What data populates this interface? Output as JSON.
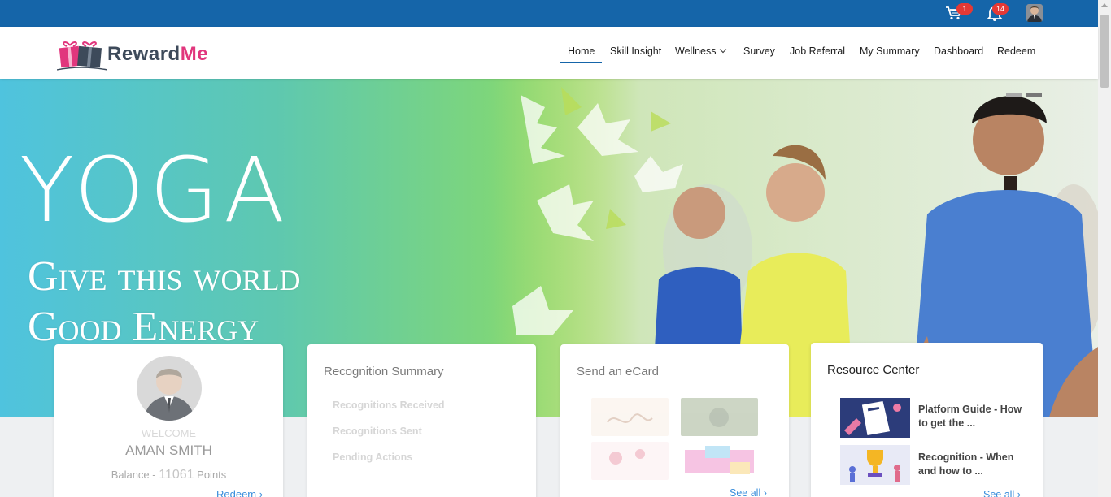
{
  "topbar": {
    "cart_count": "1",
    "notification_count": "14"
  },
  "brand": {
    "name_part1": "Reward",
    "name_part2": "Me"
  },
  "nav": {
    "items": [
      {
        "label": "Home"
      },
      {
        "label": "Skill Insight"
      },
      {
        "label": "Wellness"
      },
      {
        "label": "Survey"
      },
      {
        "label": "Job Referral"
      },
      {
        "label": "My Summary"
      },
      {
        "label": "Dashboard"
      },
      {
        "label": "Redeem"
      }
    ],
    "active": "Home"
  },
  "hero": {
    "title": "YOGA",
    "subtitle_line1": "Give this world",
    "subtitle_line2": "Good Energy"
  },
  "welcome_card": {
    "label": "WELCOME",
    "name": "AMAN SMITH",
    "balance_prefix": "Balance - ",
    "balance_points": "11061",
    "balance_suffix": " Points",
    "redeem_link": "Redeem ›"
  },
  "recognition_card": {
    "title": "Recognition Summary",
    "items": [
      {
        "label": "Recognitions Received"
      },
      {
        "label": "Recognitions Sent"
      },
      {
        "label": "Pending Actions"
      }
    ]
  },
  "ecard_card": {
    "title": "Send an eCard",
    "see_all": "See all ›"
  },
  "resource_card": {
    "title": "Resource Center",
    "items": [
      {
        "title": "Platform Guide - How to get the ..."
      },
      {
        "title": "Recognition - When and how to ..."
      }
    ],
    "see_all": "See all ›"
  },
  "colors": {
    "topbar": "#1565a9",
    "accent_pink": "#e1367d",
    "link": "#3a8edb"
  }
}
